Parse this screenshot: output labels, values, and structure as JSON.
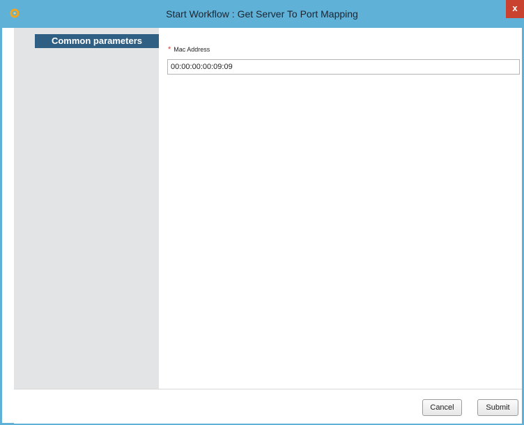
{
  "window": {
    "title": "Start Workflow : Get Server To Port Mapping",
    "close_glyph": "x",
    "app_icon": "workflow-ring-icon",
    "accent_color": "#5fb1d8"
  },
  "sidebar": {
    "items": [
      {
        "label": "Common parameters",
        "selected": true
      }
    ]
  },
  "form": {
    "fields": [
      {
        "label": "Mac Address",
        "required": true,
        "required_marker": "*",
        "value": "00:00:00:00:09:09"
      }
    ]
  },
  "footer": {
    "cancel_label": "Cancel",
    "submit_label": "Submit"
  }
}
